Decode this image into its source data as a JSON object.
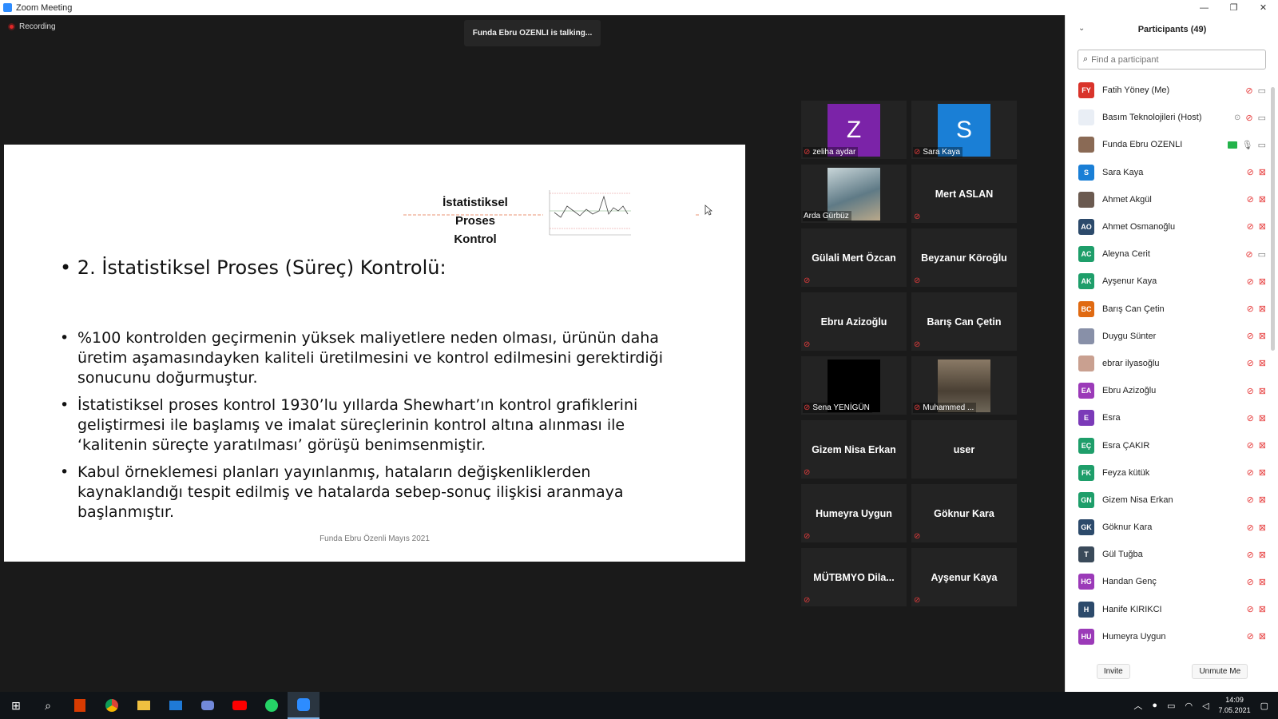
{
  "window": {
    "title": "Zoom Meeting",
    "minimize": "—",
    "maximize": "❐",
    "close": "✕"
  },
  "meeting": {
    "recording_label": "Recording",
    "talking_banner": "Funda Ebru OZENLI is talking..."
  },
  "slide": {
    "title_line1": "İstatistiksel",
    "title_line2": "Proses Kontrol",
    "heading": "2. İstatistiksel Proses (Süreç) Kontrolü:",
    "bullets": [
      "%100 kontrolden geçirmenin yüksek maliyetlere neden olması, ürünün daha üretim aşamasındayken kaliteli üretilmesini ve kontrol edilmesini gerektirdiği sonucunu doğurmuştur.",
      "İstatistiksel proses kontrol 1930’lu yıllarda Shewhart’ın kontrol grafiklerini geliştirmesi ile başlamış ve imalat süreçlerinin kontrol altına alınması ile ‘kalitenin süreçte yaratılması’ görüşü benimsenmiştir.",
      "Kabul örneklemesi planları yayınlanmış, hataların değişkenliklerden kaynaklandığı tespit edilmiş ve hatalarda sebep-sonuç ilişkisi aranmaya başlanmıştır."
    ],
    "bullet_char": "•",
    "footer": "Funda Ebru Özenli Mayıs 2021"
  },
  "tiles": [
    {
      "name": "zeliha aydar",
      "initial": "Z",
      "color": "#7b23a8"
    },
    {
      "name": "Sara Kaya",
      "initial": "S",
      "color": "#1a7fd6"
    },
    {
      "name": "Arda Gürbüz"
    },
    {
      "name": "Mert ASLAN"
    },
    {
      "name": "Gülali Mert Özcan"
    },
    {
      "name": "Beyzanur Köroğlu"
    },
    {
      "name": "Ebru Azizoğlu"
    },
    {
      "name": "Barış Can Çetin"
    },
    {
      "name": "Sena YENİGÜN"
    },
    {
      "name": "Muhammed ..."
    },
    {
      "name": "Gizem Nisa Erkan"
    },
    {
      "name": "user"
    },
    {
      "name": "Humeyra Uygun"
    },
    {
      "name": "Göknur Kara"
    },
    {
      "name": "MÜTBMYO  Dila..."
    },
    {
      "name": "Ayşenur Kaya"
    }
  ],
  "panel": {
    "title": "Participants (49)",
    "search_placeholder": "Find a participant",
    "invite": "Invite",
    "unmute_me": "Unmute Me",
    "participants": [
      {
        "initials": "FY",
        "name": "Fatih Yöney (Me)",
        "color": "#d9342b"
      },
      {
        "initials": "",
        "name": "Basım Teknolojileri (Host)",
        "color": "#e9eef5"
      },
      {
        "initials": "",
        "name": "Funda Ebru OZENLI",
        "color": "#8a6a55"
      },
      {
        "initials": "S",
        "name": "Sara Kaya",
        "color": "#1a7fd6"
      },
      {
        "initials": "",
        "name": "Ahmet Akgül",
        "color": "#6b5a50"
      },
      {
        "initials": "AO",
        "name": "Ahmet Osmanoğlu",
        "color": "#2c4a6b"
      },
      {
        "initials": "AC",
        "name": "Aleyna Cerit",
        "color": "#1e9e6a"
      },
      {
        "initials": "AK",
        "name": "Ayşenur Kaya",
        "color": "#1e9e6a"
      },
      {
        "initials": "BC",
        "name": "Barış Can Çetin",
        "color": "#e06a12"
      },
      {
        "initials": "",
        "name": "Duygu Sünter",
        "color": "#8890a8"
      },
      {
        "initials": "",
        "name": "ebrar ilyasoğlu",
        "color": "#c9a090"
      },
      {
        "initials": "EA",
        "name": "Ebru Azizoğlu",
        "color": "#9b3ab8"
      },
      {
        "initials": "E",
        "name": "Esra",
        "color": "#7b3ab8"
      },
      {
        "initials": "EÇ",
        "name": "Esra ÇAKIR",
        "color": "#1e9e6a"
      },
      {
        "initials": "FK",
        "name": "Feyza kütük",
        "color": "#1e9e6a"
      },
      {
        "initials": "GN",
        "name": "Gizem Nisa Erkan",
        "color": "#1e9e6a"
      },
      {
        "initials": "GK",
        "name": "Göknur Kara",
        "color": "#2c4a6b"
      },
      {
        "initials": "T",
        "name": "Gül Tuğba",
        "color": "#3a4a5a"
      },
      {
        "initials": "HG",
        "name": "Handan Genç",
        "color": "#9b3ab8"
      },
      {
        "initials": "H",
        "name": "Hanife KIRIKCI",
        "color": "#2c4a6b"
      },
      {
        "initials": "HU",
        "name": "Humeyra Uygun",
        "color": "#9b3ab8"
      }
    ]
  },
  "taskbar": {
    "time": "14:09",
    "date": "7.05.2021"
  }
}
